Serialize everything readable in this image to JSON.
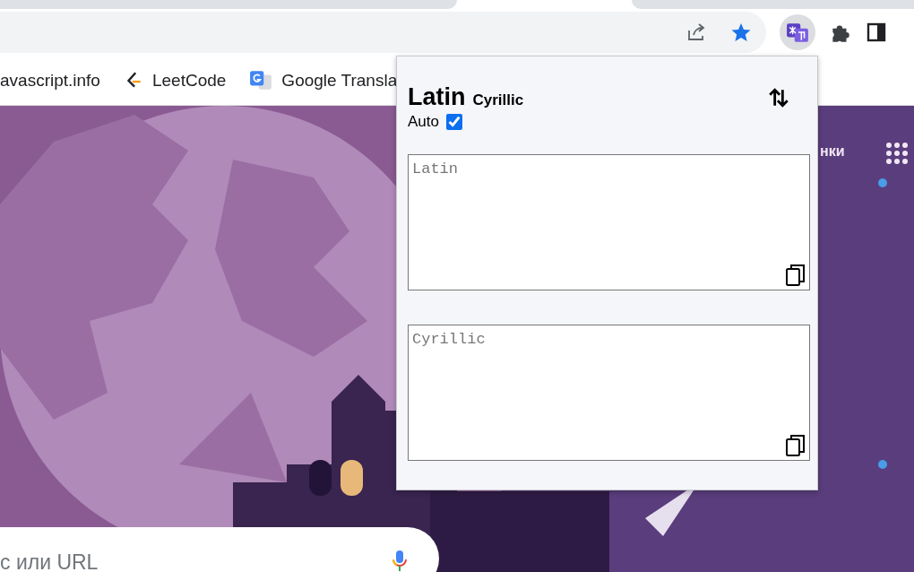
{
  "bookmarks": [
    {
      "kind": "plain",
      "label": "avascript.info"
    },
    {
      "kind": "leetcode",
      "label": "LeetCode"
    },
    {
      "kind": "translate",
      "label": "Google Transla"
    }
  ],
  "page": {
    "nav_link": "нки",
    "search": {
      "placeholder": "с или URL"
    }
  },
  "popup": {
    "source_script": "Latin",
    "target_script": "Cyrillic",
    "auto": {
      "label": "Auto",
      "checked": true
    },
    "fields": [
      {
        "placeholder": "Latin"
      },
      {
        "placeholder": "Cyrillic"
      }
    ]
  }
}
